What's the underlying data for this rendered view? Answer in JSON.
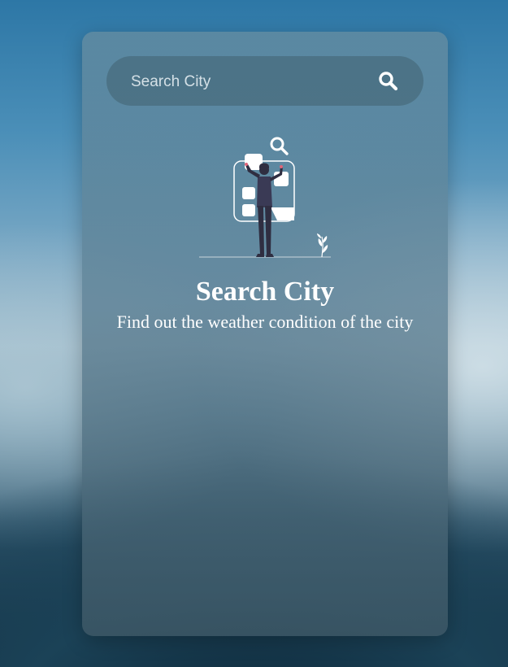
{
  "search": {
    "placeholder": "Search City",
    "button_icon": "search-icon"
  },
  "empty_state": {
    "illustration_icon": "person-searching-illustration",
    "title": "Search City",
    "subtitle": "Find out the weather condition of the city"
  },
  "colors": {
    "text": "#ffffff",
    "accent_figure": "#2f2e41"
  }
}
